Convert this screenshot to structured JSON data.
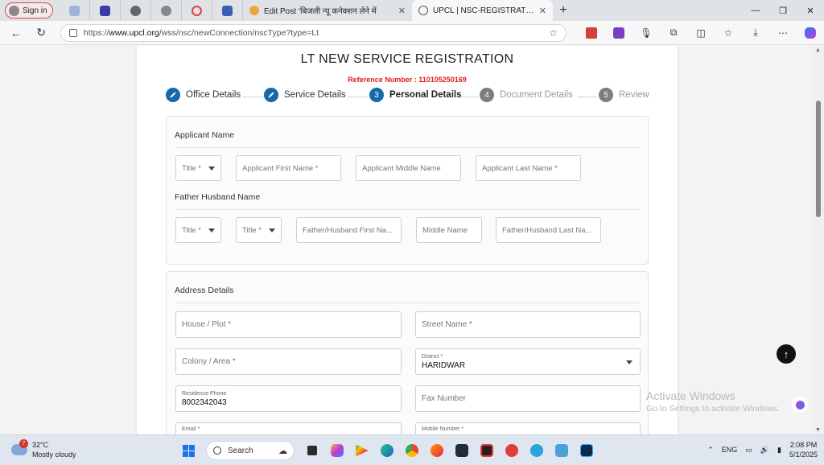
{
  "browser": {
    "profile_label": "Sign in",
    "tabs": [
      {
        "title": "Edit Post ‘बिजली न्यू कनेक्शन लेने में"
      },
      {
        "title": "UPCL | NSC-REGISTRATION"
      }
    ],
    "url_prefix": "https://",
    "url_host": "www.upcl.org",
    "url_path": "/wss/nsc/newConnection/nscType?type=Lt"
  },
  "page": {
    "heading": "LT NEW SERVICE REGISTRATION",
    "reference": "Reference Number : 110105250169",
    "steps": [
      {
        "num": "",
        "label": "Office Details",
        "state": "done"
      },
      {
        "num": "",
        "label": "Service Details",
        "state": "done"
      },
      {
        "num": "3",
        "label": "Personal Details",
        "state": "current"
      },
      {
        "num": "4",
        "label": "Document Details",
        "state": "todo"
      },
      {
        "num": "5",
        "label": "Review",
        "state": "todo"
      }
    ]
  },
  "applicant": {
    "section_title": "Applicant Name",
    "title": "Title *",
    "first_name": "Applicant First Name *",
    "middle_name": "Applicant Middle Name",
    "last_name": "Applicant Last Name *",
    "father_title": "Father Husband Name",
    "father_title_1": "Title *",
    "father_title_2": "Title *",
    "father_first": "Father/Husband First Na...",
    "father_middle": "Middle Name",
    "father_last": "Father/Husband Last Na..."
  },
  "address": {
    "section_title": "Address Details",
    "house": "House / Plot *",
    "street": "Street Name *",
    "colony": "Colony / Area *",
    "district_label": "District *",
    "district_value": "HARIDWAR",
    "residence_label": "Residence Phone",
    "residence_value": "8002342043",
    "fax": "Fax Number",
    "email_label": "Email *",
    "mobile_label": "Mobile Number *"
  },
  "overlay": {
    "activate_title": "Activate Windows",
    "activate_sub": "Go to Settings to activate Windows."
  },
  "taskbar": {
    "temp": "32°C",
    "weather": "Mostly cloudy",
    "weather_badge": "7",
    "search": "Search",
    "lang": "ENG",
    "time": "2:08 PM",
    "date": "5/1/2025"
  }
}
